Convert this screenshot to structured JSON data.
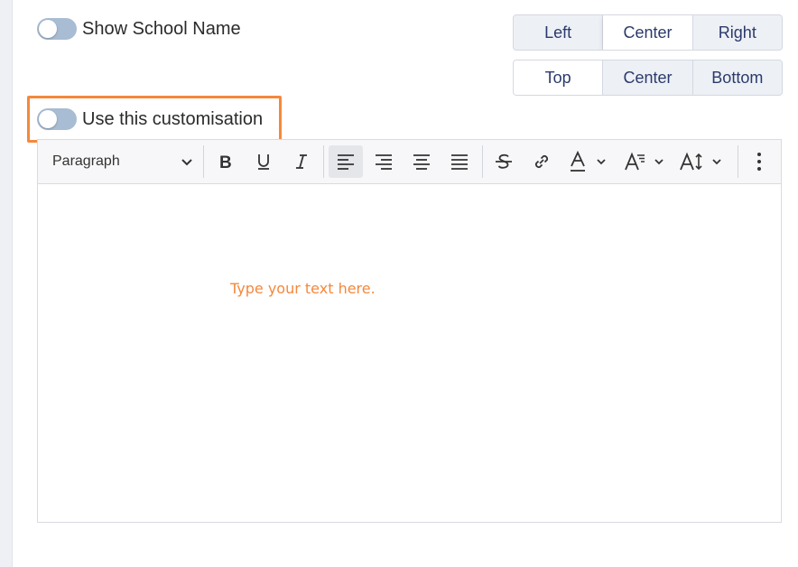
{
  "settings": {
    "show_school_name": {
      "label": "Show School Name",
      "enabled": false
    },
    "use_customisation": {
      "label": "Use this customisation",
      "enabled": false
    }
  },
  "horizontal_align": {
    "options": [
      "Left",
      "Center",
      "Right"
    ],
    "selected": "Center"
  },
  "vertical_align": {
    "options": [
      "Top",
      "Center",
      "Bottom"
    ],
    "selected": "Top"
  },
  "editor": {
    "block_format": "Paragraph",
    "placeholder": "Type your text here.",
    "toolbar_icons": [
      "bold-icon",
      "underline-icon",
      "italic-icon",
      "align-left-icon",
      "align-right-icon",
      "align-center-icon",
      "align-justify-icon",
      "strikethrough-icon",
      "link-icon",
      "text-color-icon",
      "font-size-icon",
      "line-height-icon",
      "more-icon"
    ],
    "active_alignment": "left"
  },
  "colors": {
    "highlight": "#f5883c",
    "toggle_off": "#a8bcd3",
    "segment_text": "#2b3a6b"
  }
}
